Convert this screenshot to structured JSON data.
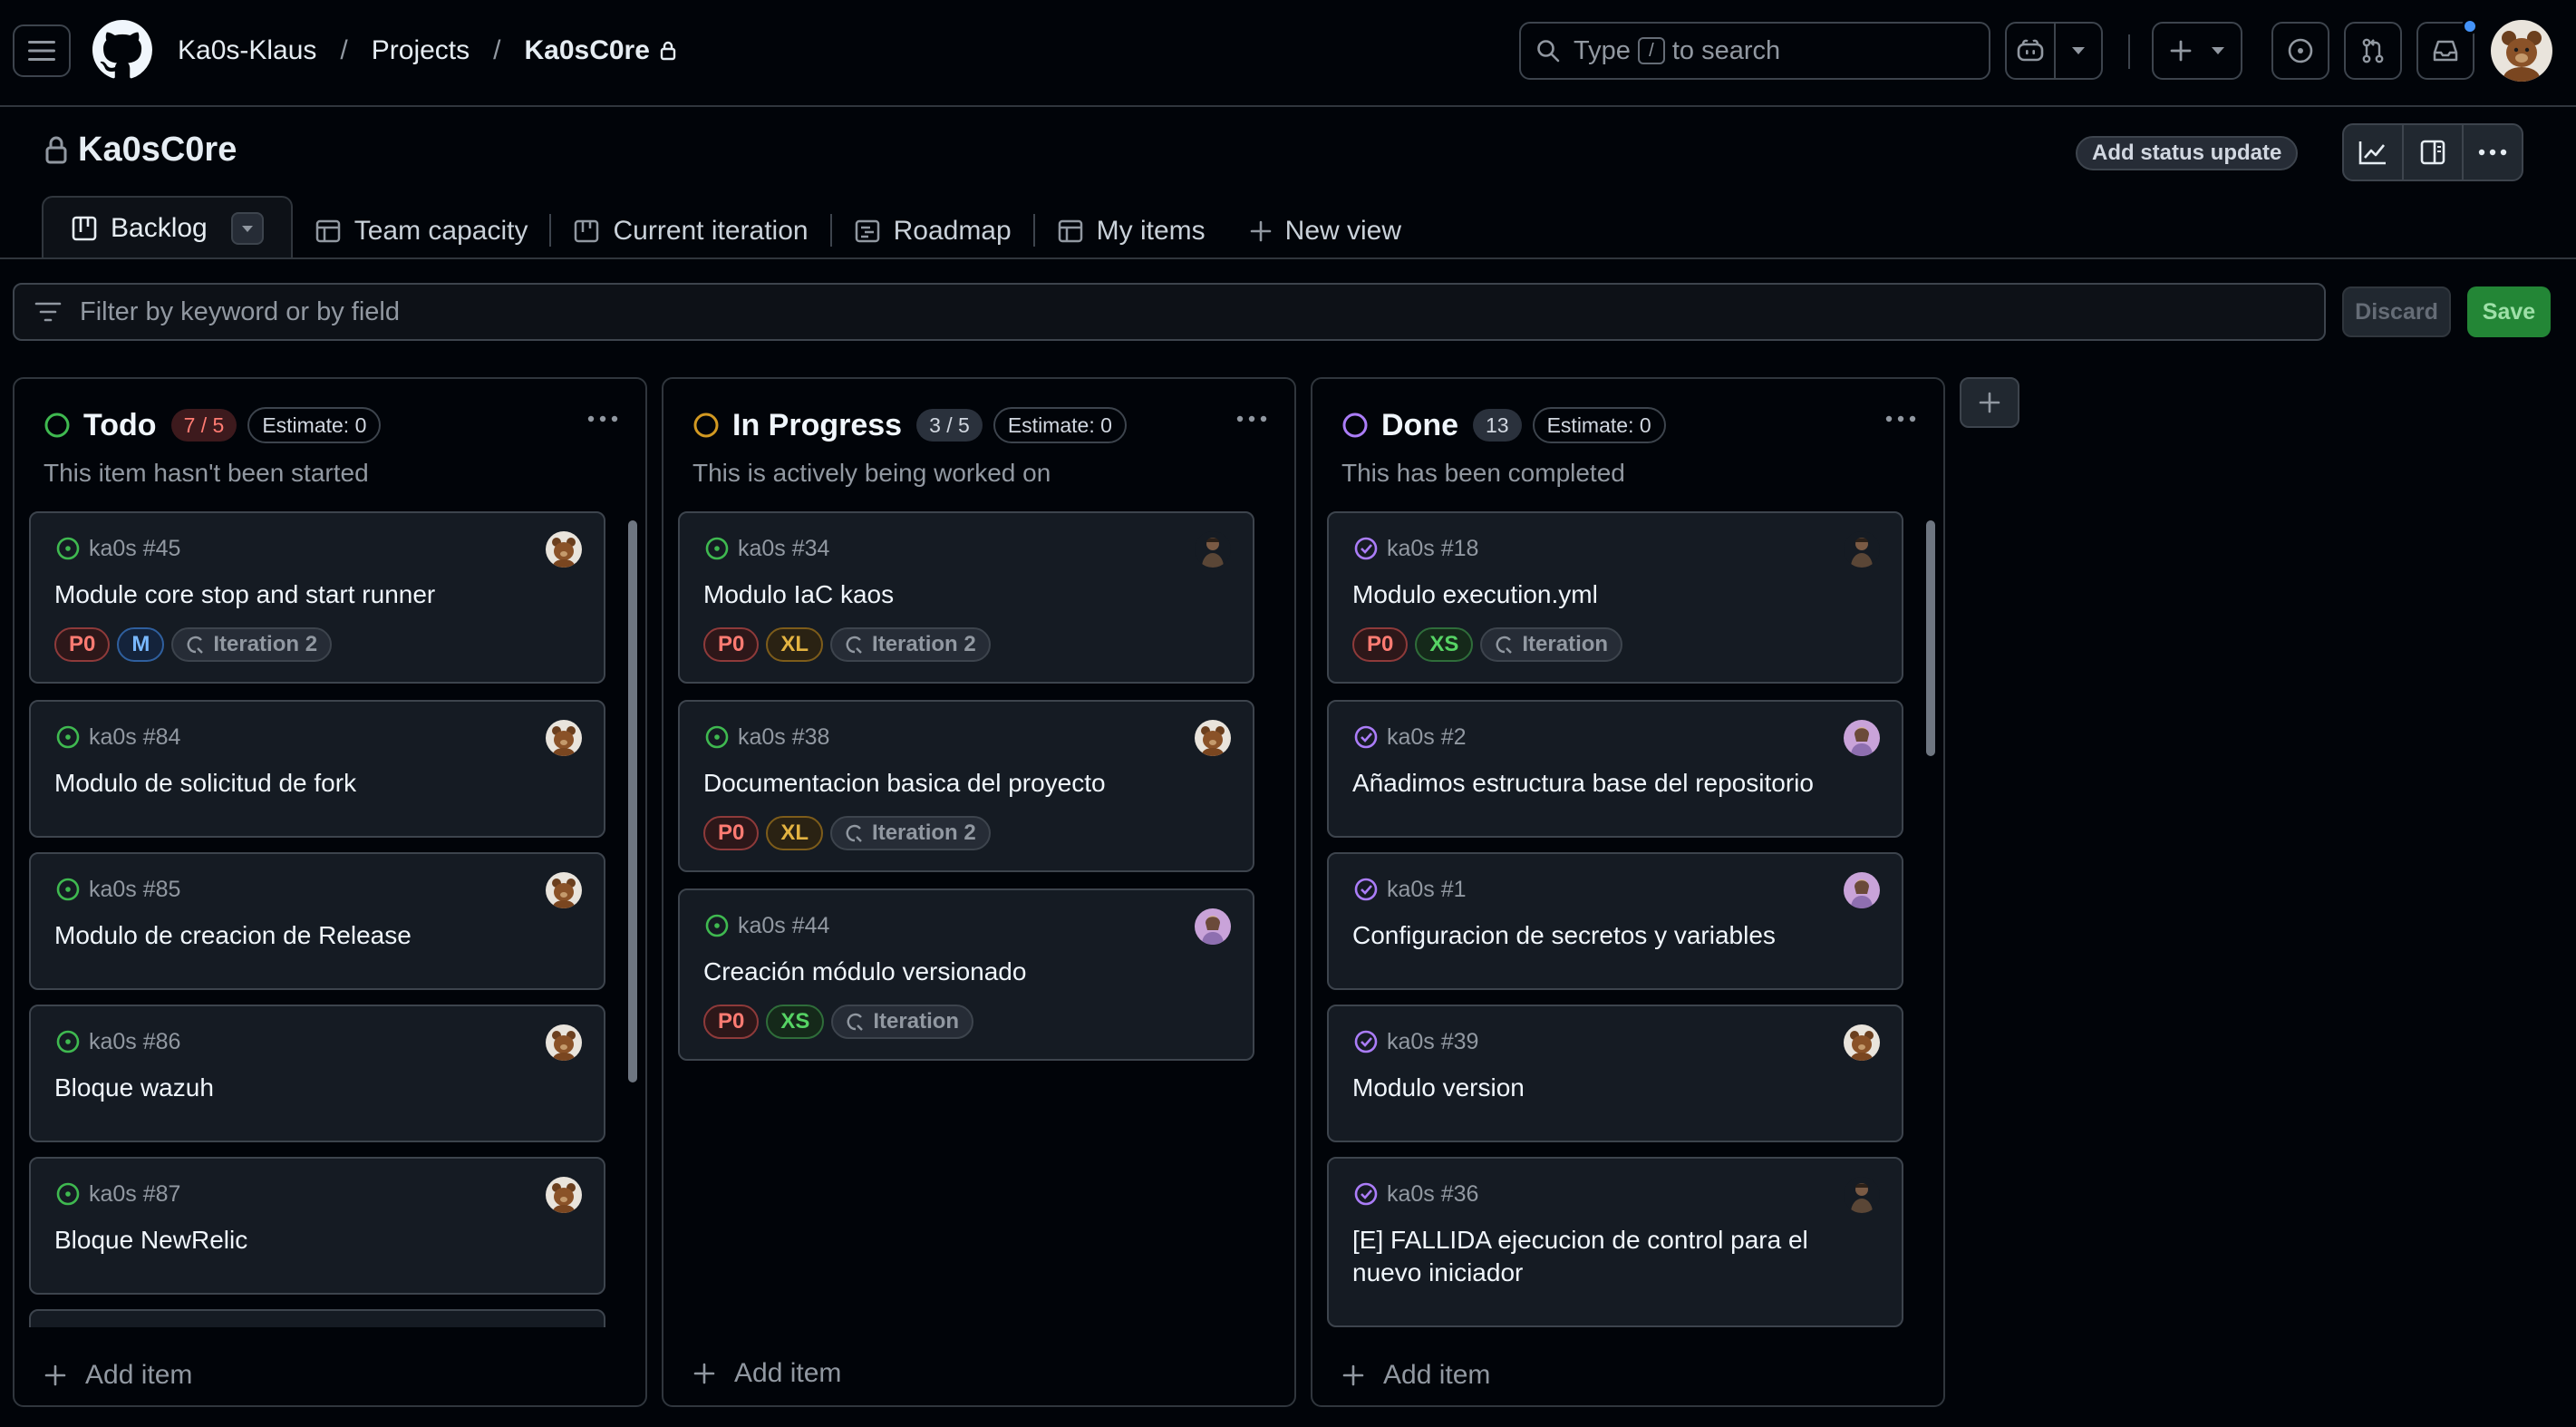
{
  "header": {
    "owner": "Ka0s-Klaus",
    "section": "Projects",
    "project": "Ka0sC0re",
    "search_prefix": "Type",
    "search_key": "/",
    "search_suffix": "to search"
  },
  "project": {
    "title": "Ka0sC0re",
    "status_button": "Add status update"
  },
  "tabs": [
    {
      "label": "Backlog",
      "icon": "board-icon",
      "active": true
    },
    {
      "label": "Team capacity",
      "icon": "table-icon"
    },
    {
      "label": "Current iteration",
      "icon": "board-icon"
    },
    {
      "label": "Roadmap",
      "icon": "roadmap-icon"
    },
    {
      "label": "My items",
      "icon": "table-icon"
    },
    {
      "label": "New view",
      "icon": "plus-icon"
    }
  ],
  "filter": {
    "placeholder": "Filter by keyword or by field",
    "discard_label": "Discard",
    "save_label": "Save"
  },
  "columns": [
    {
      "name": "Todo",
      "count": "7 / 5",
      "estimate": "Estimate: 0",
      "description": "This item hasn't been started",
      "status_color": "#3fb950",
      "add_label": "Add item",
      "cards": [
        {
          "ref": "ka0s #45",
          "title": "Module core stop and start runner",
          "labels": [
            "P0",
            "M",
            "Iteration 2"
          ]
        },
        {
          "ref": "ka0s #84",
          "title": "Modulo de solicitud de fork",
          "labels": []
        },
        {
          "ref": "ka0s #85",
          "title": "Modulo de creacion de Release",
          "labels": []
        },
        {
          "ref": "ka0s #86",
          "title": "Bloque wazuh",
          "labels": []
        },
        {
          "ref": "ka0s #87",
          "title": "Bloque NewRelic",
          "labels": []
        }
      ]
    },
    {
      "name": "In Progress",
      "count": "3 / 5",
      "estimate": "Estimate: 0",
      "description": "This is actively being worked on",
      "status_color": "#d29922",
      "add_label": "Add item",
      "cards": [
        {
          "ref": "ka0s #34",
          "title": "Modulo IaC kaos",
          "labels": [
            "P0",
            "XL",
            "Iteration 2"
          ]
        },
        {
          "ref": "ka0s #38",
          "title": "Documentacion basica del proyecto",
          "labels": [
            "P0",
            "XL",
            "Iteration 2"
          ]
        },
        {
          "ref": "ka0s #44",
          "title": "Creación módulo versionado",
          "labels": [
            "P0",
            "XS",
            "Iteration"
          ]
        }
      ]
    },
    {
      "name": "Done",
      "count": "13",
      "estimate": "Estimate: 0",
      "description": "This has been completed",
      "status_color": "#ab7df8",
      "add_label": "Add item",
      "cards": [
        {
          "ref": "ka0s #18",
          "title": "Modulo execution.yml",
          "labels": [
            "P0",
            "XS",
            "Iteration"
          ]
        },
        {
          "ref": "ka0s #2",
          "title": "Añadimos estructura base del repositorio",
          "labels": []
        },
        {
          "ref": "ka0s #1",
          "title": "Configuracion de secretos y variables",
          "labels": []
        },
        {
          "ref": "ka0s #39",
          "title": "Modulo version",
          "labels": []
        },
        {
          "ref": "ka0s #36",
          "title": "[E] FALLIDA ejecucion de control para el nuevo iniciador",
          "labels": []
        }
      ]
    }
  ]
}
